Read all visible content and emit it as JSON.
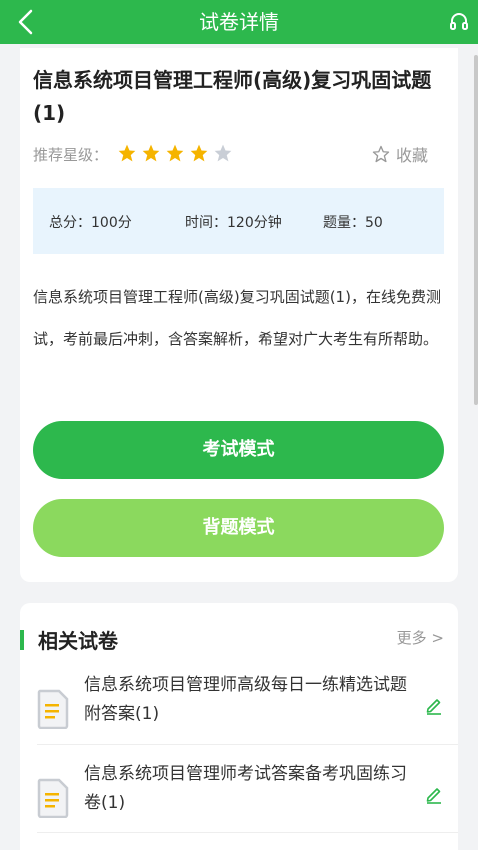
{
  "header": {
    "title": "试卷详情",
    "back_icon": "chevron-left-icon",
    "right_icon": "headset-icon"
  },
  "paper": {
    "title": "信息系统项目管理工程师(高级)复习巩固试题(1)",
    "rating_label": "推荐星级：",
    "rating": 4,
    "rating_max": 5,
    "favorite_label": "收藏",
    "total_score": "总分：100分",
    "time": "时间：120分钟",
    "question_count": "题量：50",
    "description": "信息系统项目管理工程师(高级)复习巩固试题(1)，在线免费测试，考前最后冲刺，含答案解析，希望对广大考生有所帮助。",
    "exam_mode_label": "考试模式",
    "study_mode_label": "背题模式"
  },
  "related": {
    "title": "相关试卷",
    "more_label": "更多 >",
    "items": [
      {
        "title": "信息系统项目管理师高级每日一练精选试题附答案(1)"
      },
      {
        "title": "信息系统项目管理师考试答案备考巩固练习卷(1)"
      }
    ]
  },
  "colors": {
    "primary": "#2db84d",
    "secondary": "#8bd95e",
    "star_active": "#f5b400",
    "star_inactive": "#c9ced6",
    "info_bg": "#e8f4fd"
  }
}
